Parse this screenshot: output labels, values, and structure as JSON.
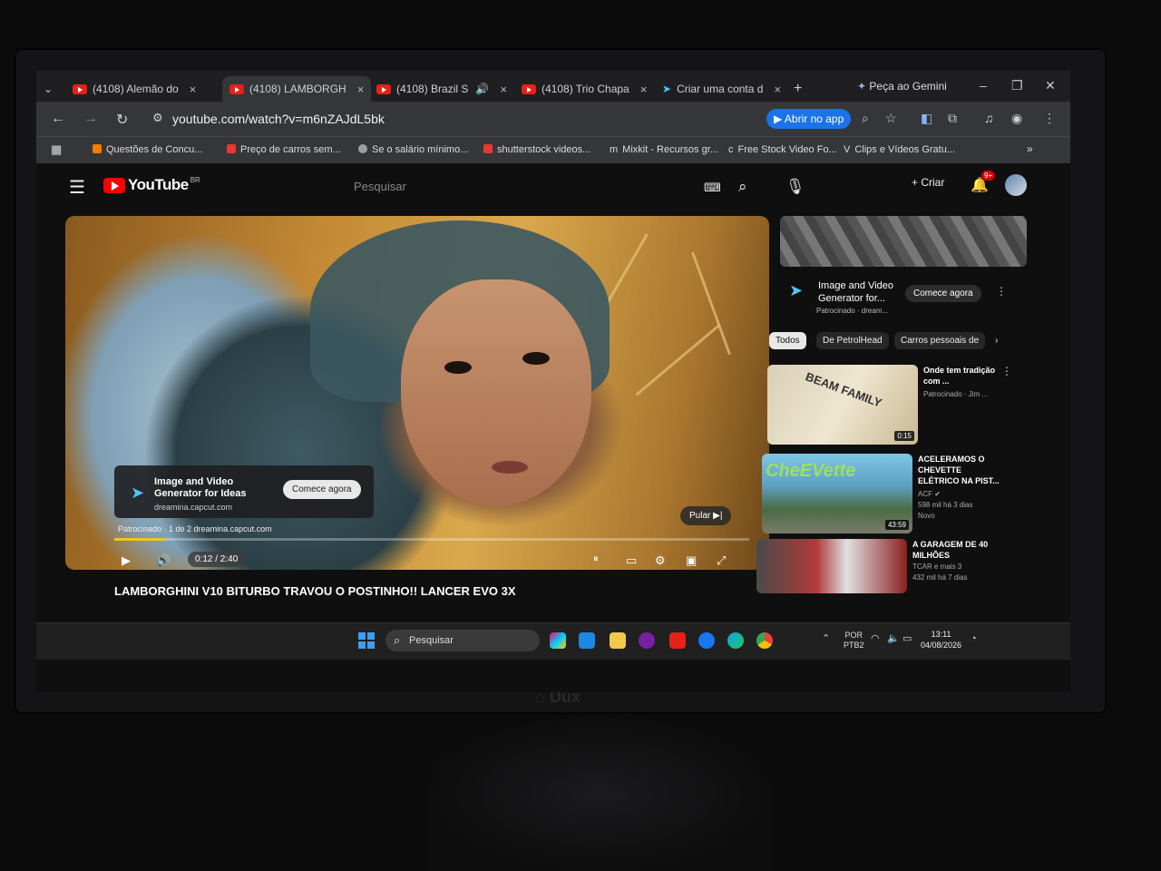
{
  "tabs": [
    {
      "title": "(4108) Alemão do"
    },
    {
      "title": "(4108) LAMBORGH"
    },
    {
      "title": "(4108) Brazil S"
    },
    {
      "title": "(4108) Trio Chapa"
    },
    {
      "title": "Criar uma conta d"
    }
  ],
  "tab_close": "×",
  "new_tab": "+",
  "gemini": "Peça ao Gemini",
  "window_controls": {
    "minimize": "–",
    "restore": "❐",
    "close": "✕"
  },
  "address": {
    "url": "youtube.com/watch?v=m6nZAJdL5bk",
    "open_app": "Abrir no app"
  },
  "bookmarks": [
    {
      "label": "Questões de Concu...",
      "color": "#f57c00"
    },
    {
      "label": "Preço de carros sem...",
      "color": "#e53935"
    },
    {
      "label": "Se o salário mínimo...",
      "color": "#9e9e9e"
    },
    {
      "label": "shutterstock videos...",
      "color": "#e53935"
    },
    {
      "label": "Mixkit - Recursos gr...",
      "color": "#35363a"
    },
    {
      "label": "Free Stock Video Fo...",
      "color": "#35363a"
    },
    {
      "label": "Clips e Vídeos Gratu...",
      "color": "#35363a"
    }
  ],
  "youtube": {
    "logo": "YouTube",
    "region": "BR",
    "search_placeholder": "Pesquisar",
    "create": "+ Criar",
    "notifications": "9+"
  },
  "player": {
    "ad_title": "Image and Video Generator for Ideas",
    "ad_url": "dreamina.capcut.com",
    "ad_button": "Comece agora",
    "ad_line": "Patrocinado · 1 de 2   dreamina.capcut.com",
    "skip": "Pular",
    "time": "0:12 / 2:40",
    "progress": 0.08
  },
  "video_title": "LAMBORGHINI V10 BITURBO TRAVOU O POSTINHO!! LANCER EVO 3X",
  "sidebar": {
    "sponsor_title": "Image and Video Generator for...",
    "sponsor_sub": "Patrocinado · dream...",
    "sponsor_button": "Comece agora",
    "chips": [
      "Todos",
      "De PetrolHead",
      "Carros pessoais de"
    ],
    "videos": [
      {
        "title": "Onde tem tradição com ...",
        "meta1": "Patrocinado · Jim ...",
        "meta2": "",
        "meta3": "",
        "duration": "0:15"
      },
      {
        "title": "ACELERAMOS O CHEVETTE ELÉTRICO NA PIST...",
        "meta1": "ACF ✔",
        "meta2": "598 mil  há 3 dias",
        "meta3": "Novo",
        "duration": "43:59"
      },
      {
        "title": "A GARAGEM DE 40 MILHÕES",
        "meta1": "TCAR e mais 3",
        "meta2": "432 mil  há 7 dias",
        "meta3": "",
        "duration": ""
      }
    ]
  },
  "taskbar": {
    "search": "Pesquisar",
    "lang1": "POR",
    "lang2": "PTB2",
    "time": "13:11",
    "date": "04/08/2026"
  }
}
